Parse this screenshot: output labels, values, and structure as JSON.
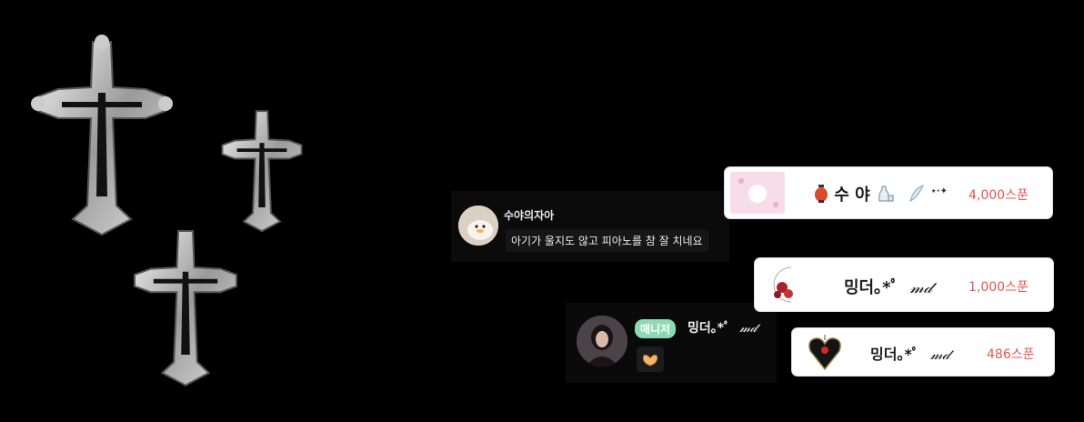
{
  "chat_messages": [
    {
      "username": "수야의자아",
      "text": "아기가 울지도 않고 피아노를 참 잘 치네요"
    },
    {
      "badge": "매니저",
      "username": "밍더｡*ﾟ",
      "signature": "𝓂𝒹"
    }
  ],
  "donations": [
    {
      "donor": "수 야",
      "amount": "4,000스푼",
      "icons": [
        "lantern-icon",
        "sake-icon",
        "wing-icon",
        "sparkle-icon"
      ]
    },
    {
      "donor": "밍더｡*ﾟ",
      "signature": "𝓂𝒹",
      "amount": "1,000스푼"
    },
    {
      "donor": "밍더｡*ﾟ",
      "signature": "𝓂𝒹",
      "amount": "486스푼"
    }
  ],
  "colors": {
    "amount": "#e5554d",
    "manager_badge": "#8ed9b2",
    "background": "#000000"
  }
}
